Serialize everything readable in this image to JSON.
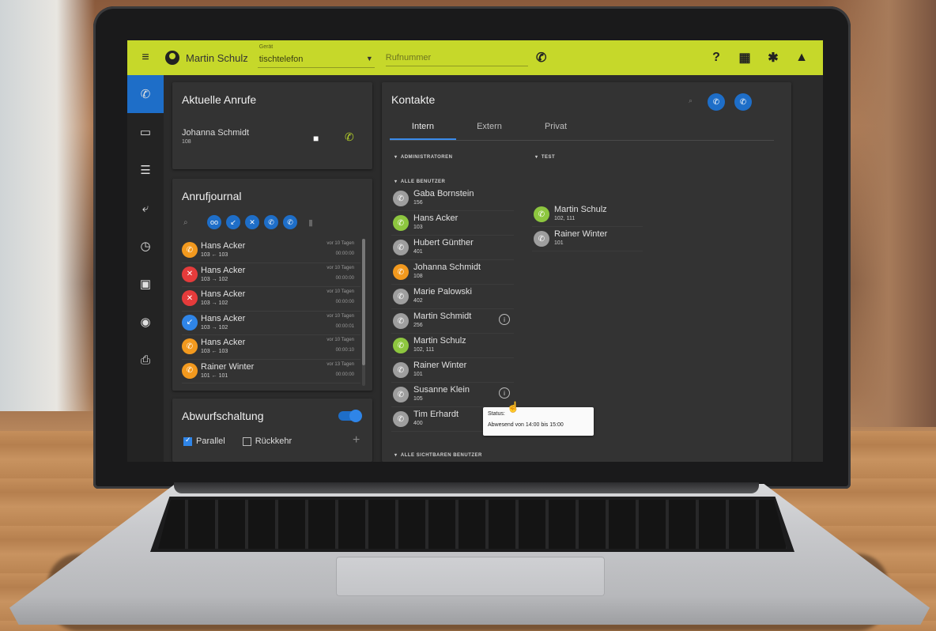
{
  "topbar": {
    "user_name": "Martin Schulz",
    "device_label": "Gerät",
    "device_value": "tischtelefon",
    "number_placeholder": "Rufnummer"
  },
  "current_calls": {
    "title": "Aktuelle Anrufe",
    "caller_name": "Johanna Schmidt",
    "caller_number": "108"
  },
  "journal": {
    "title": "Anrufjournal",
    "rows": [
      {
        "name": "Hans Acker",
        "sub": "103 ← 103",
        "when": "vor 10 Tagen",
        "duration": "00:00:00",
        "status": "orange"
      },
      {
        "name": "Hans Acker",
        "sub": "103 → 102",
        "when": "vor 10 Tagen",
        "duration": "00:00:00",
        "status": "red"
      },
      {
        "name": "Hans Acker",
        "sub": "103 → 102",
        "when": "vor 10 Tagen",
        "duration": "00:00:00",
        "status": "red"
      },
      {
        "name": "Hans Acker",
        "sub": "103 → 102",
        "when": "vor 10 Tagen",
        "duration": "00:00:01",
        "status": "blue"
      },
      {
        "name": "Hans Acker",
        "sub": "103 ← 103",
        "when": "vor 10 Tagen",
        "duration": "00:00:10",
        "status": "orange"
      },
      {
        "name": "Rainer Winter",
        "sub": "101 ← 101",
        "when": "vor 13 Tagen",
        "duration": "00:00:00",
        "status": "orange"
      }
    ]
  },
  "forwarding": {
    "title": "Abwurfschaltung",
    "parallel_label": "Parallel",
    "return_label": "Rückkehr"
  },
  "contacts": {
    "title": "Kontakte",
    "tabs": [
      "Intern",
      "Extern",
      "Privat"
    ],
    "group_admins": "ADMINISTRATOREN",
    "group_all_users": "ALLE BENUTZER",
    "group_test": "TEST",
    "group_all_visible": "ALLE SICHTBAREN BENUTZER",
    "all_users": [
      {
        "name": "Gaba Bornstein",
        "ext": "156",
        "status": "grey"
      },
      {
        "name": "Hans Acker",
        "ext": "103",
        "status": "green"
      },
      {
        "name": "Hubert Günther",
        "ext": "401",
        "status": "grey"
      },
      {
        "name": "Johanna Schmidt",
        "ext": "108",
        "status": "orange"
      },
      {
        "name": "Marie Palowski",
        "ext": "402",
        "status": "grey"
      },
      {
        "name": "Martin Schmidt",
        "ext": "256",
        "status": "grey"
      },
      {
        "name": "Martin Schulz",
        "ext": "102, 111",
        "status": "green"
      },
      {
        "name": "Rainer Winter",
        "ext": "101",
        "status": "grey"
      },
      {
        "name": "Susanne Klein",
        "ext": "105",
        "status": "grey"
      },
      {
        "name": "Tim Erhardt",
        "ext": "400",
        "status": "grey"
      }
    ],
    "test_users": [
      {
        "name": "Martin Schulz",
        "ext": "102, 111",
        "status": "green"
      },
      {
        "name": "Rainer Winter",
        "ext": "101",
        "status": "grey"
      }
    ]
  },
  "tooltip": {
    "title": "Status:",
    "text": "Abwesend von 14:00 bis 15:00"
  }
}
